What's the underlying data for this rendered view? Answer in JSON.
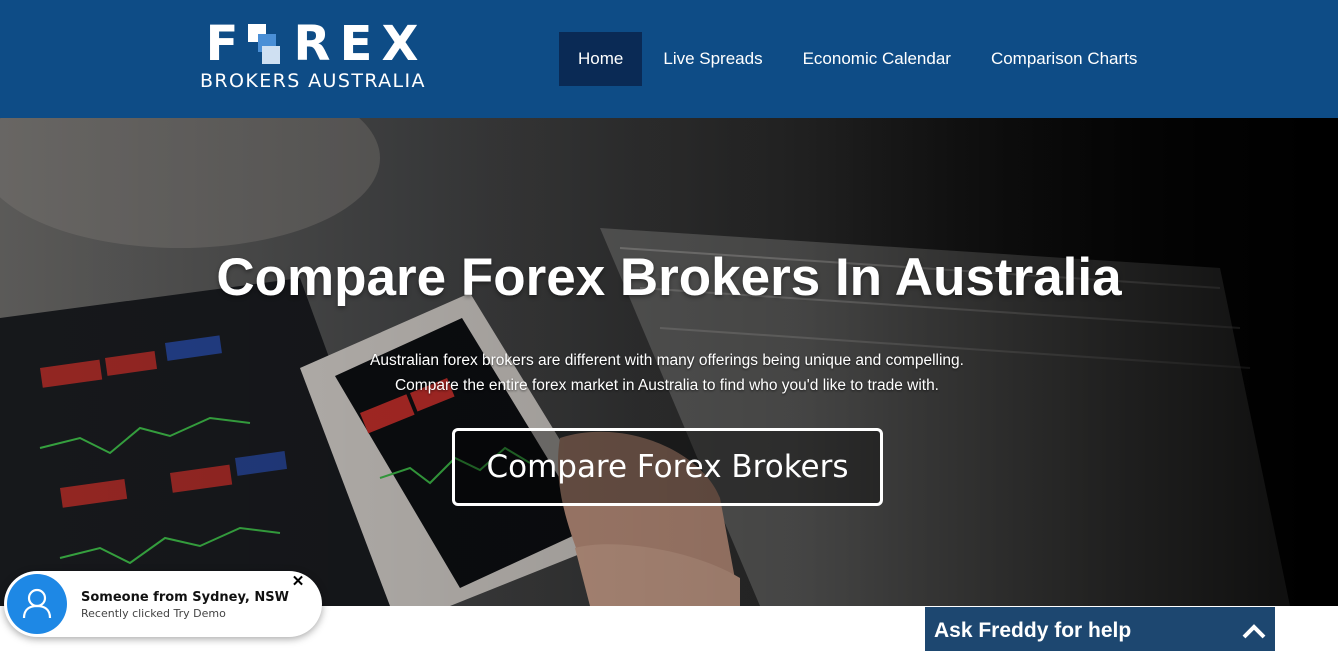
{
  "logo": {
    "letters_left": "F",
    "letters_right": [
      "R",
      "E",
      "X"
    ],
    "subtitle": "BROKERS AUSTRALIA"
  },
  "nav": {
    "items": [
      {
        "label": "Home",
        "active": true
      },
      {
        "label": "Live Spreads",
        "active": false
      },
      {
        "label": "Economic Calendar",
        "active": false
      },
      {
        "label": "Comparison Charts",
        "active": false
      }
    ]
  },
  "hero": {
    "title": "Compare Forex Brokers In Australia",
    "subtitle_line1": "Australian forex brokers are different with many offerings being unique and compelling.",
    "subtitle_line2": "Compare the entire forex market in Australia to find who you'd like to trade with.",
    "cta_label": "Compare Forex Brokers"
  },
  "toast": {
    "title": "Someone from Sydney, NSW",
    "text": "Recently clicked Try Demo",
    "close_icon": "close-icon",
    "avatar_icon": "user-icon"
  },
  "chat": {
    "label": "Ask Freddy for help",
    "toggle_icon": "chevron-up-icon"
  },
  "colors": {
    "header_bg": "#0e4c86",
    "nav_active_bg": "#0a2a55",
    "chat_bg": "#1d4770",
    "avatar_bg": "#1e88e5"
  }
}
